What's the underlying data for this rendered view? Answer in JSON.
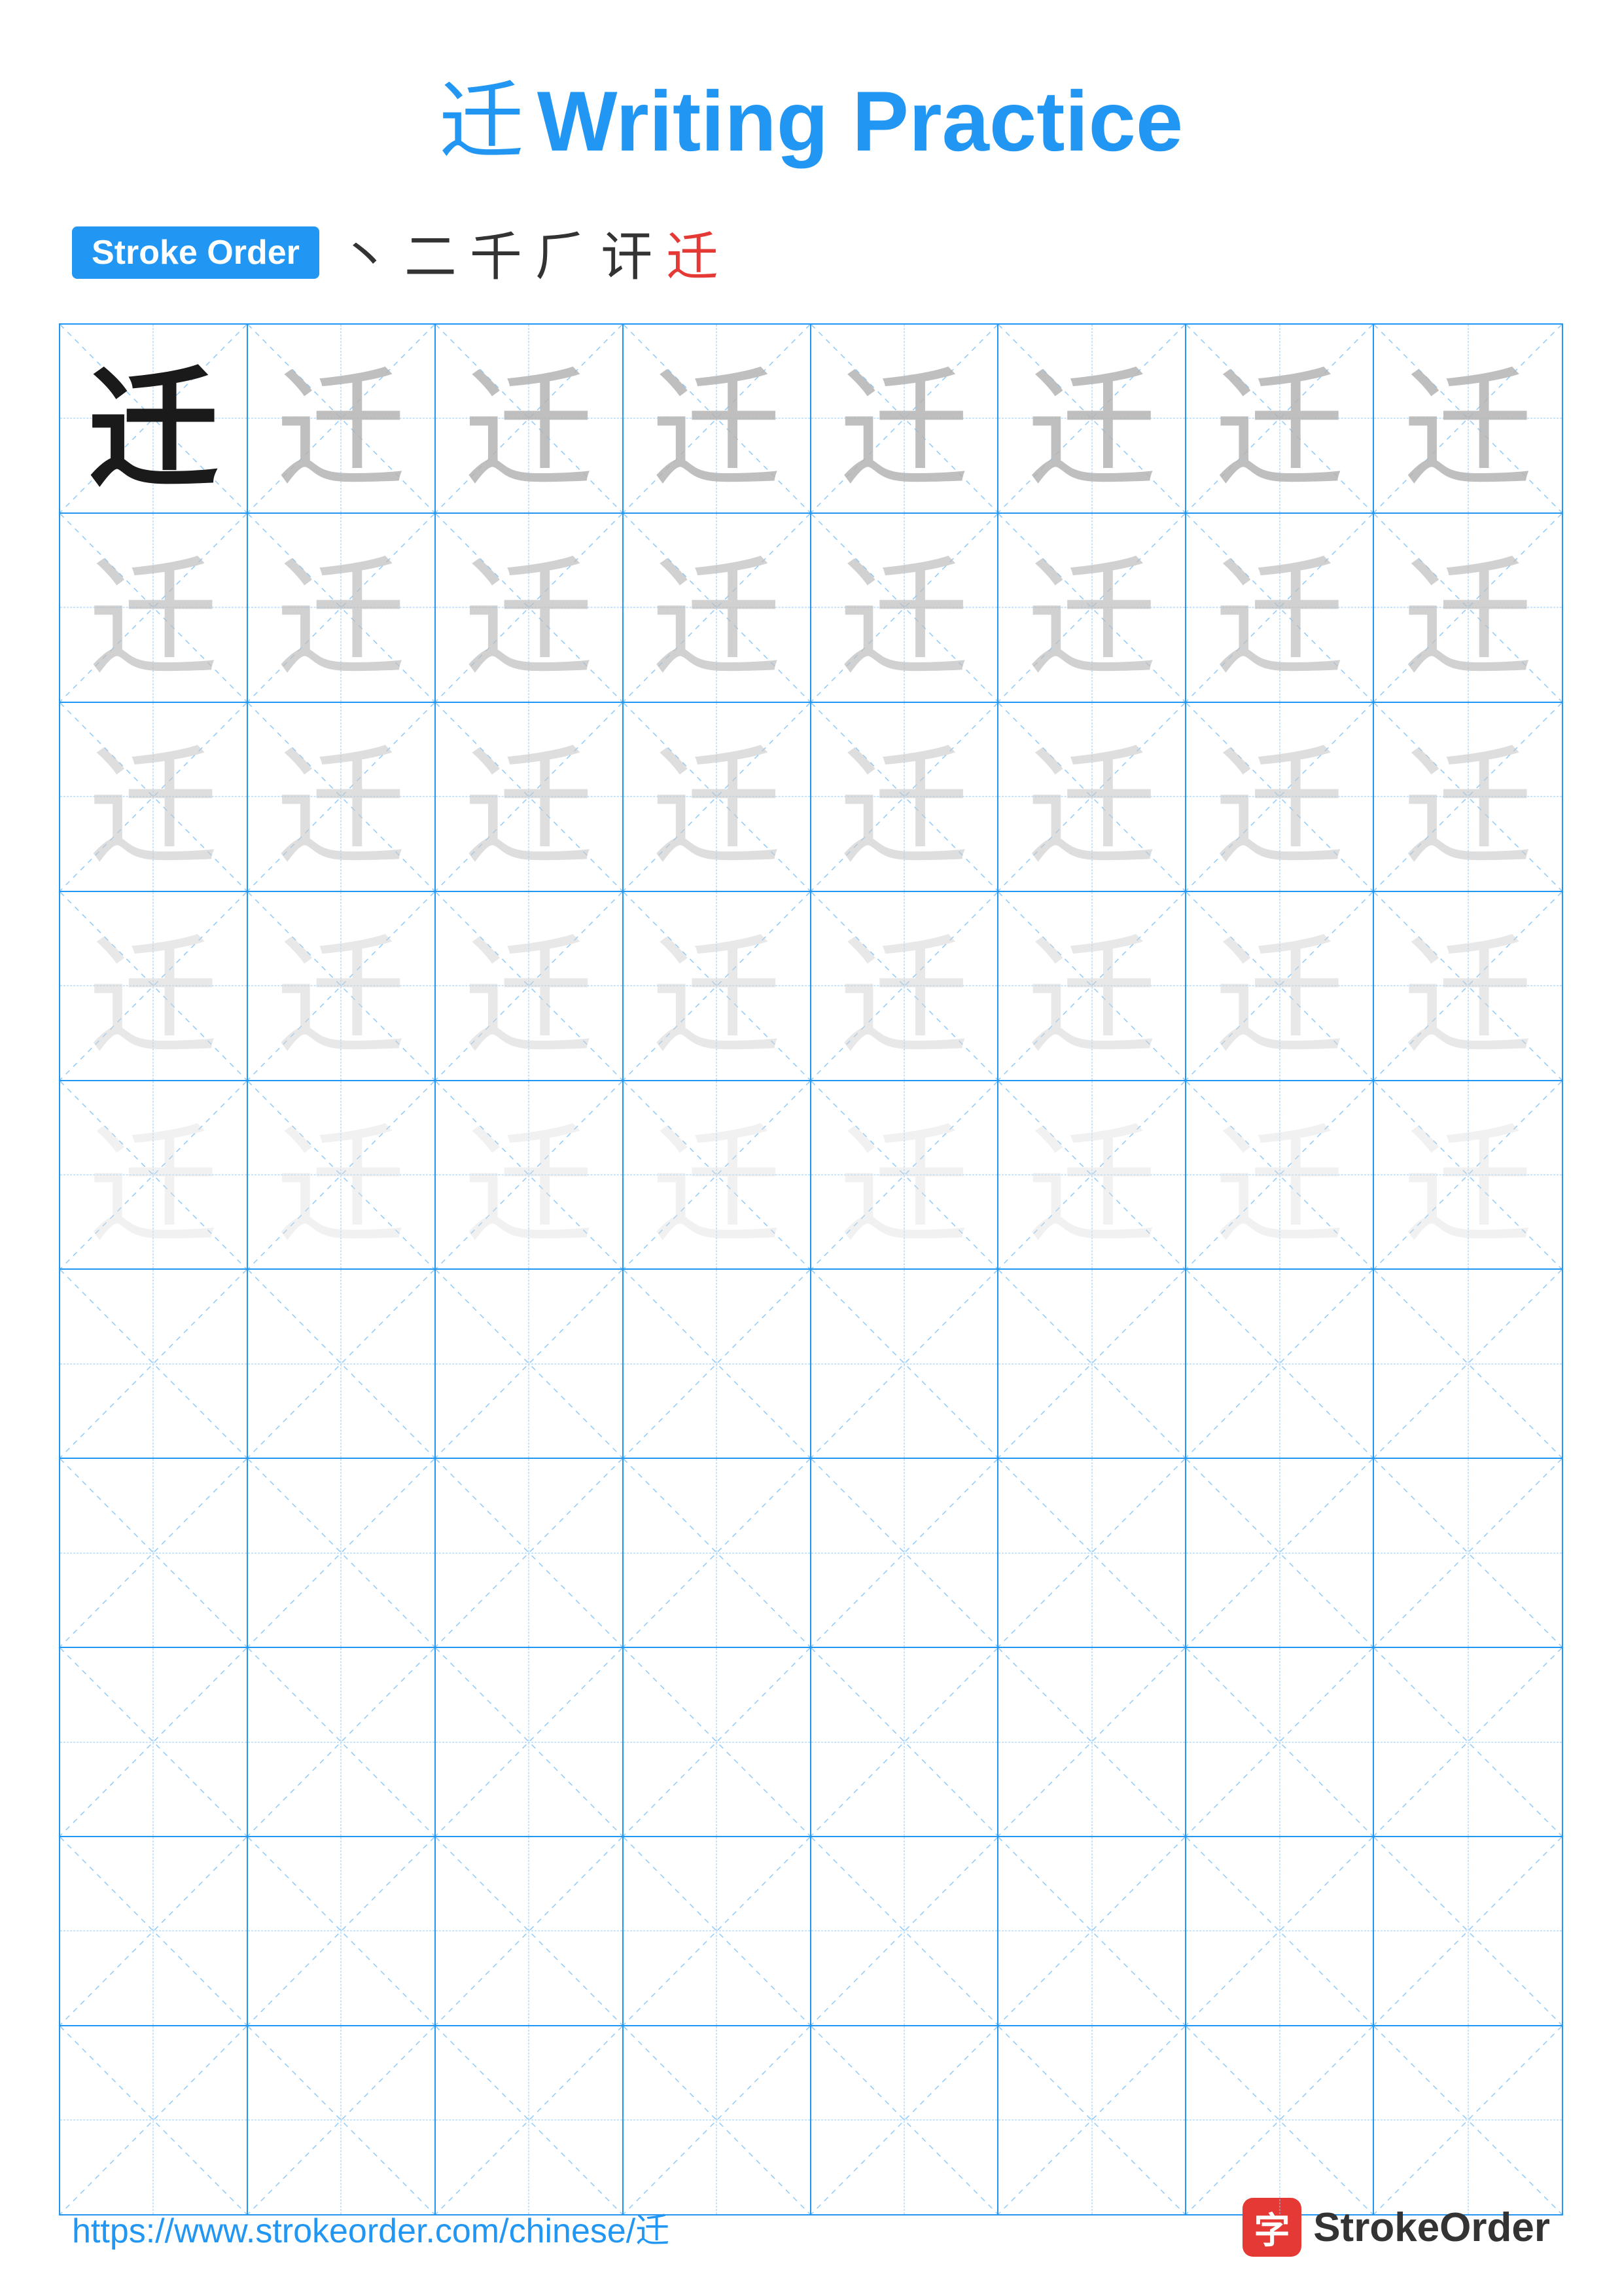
{
  "title": {
    "char": "迁",
    "text": "Writing Practice"
  },
  "stroke_order": {
    "badge": "Stroke Order",
    "sequence": [
      "丶",
      "二",
      "千",
      "⺁",
      "讦",
      "迁"
    ]
  },
  "grid": {
    "rows": 10,
    "cols": 8,
    "char": "迁",
    "filled_rows": 5,
    "opacity_levels": [
      "dark",
      "light1",
      "light2",
      "light3",
      "light4"
    ]
  },
  "footer": {
    "url": "https://www.strokeorder.com/chinese/迁",
    "brand_char": "字",
    "brand_text": "StrokeOrder"
  }
}
